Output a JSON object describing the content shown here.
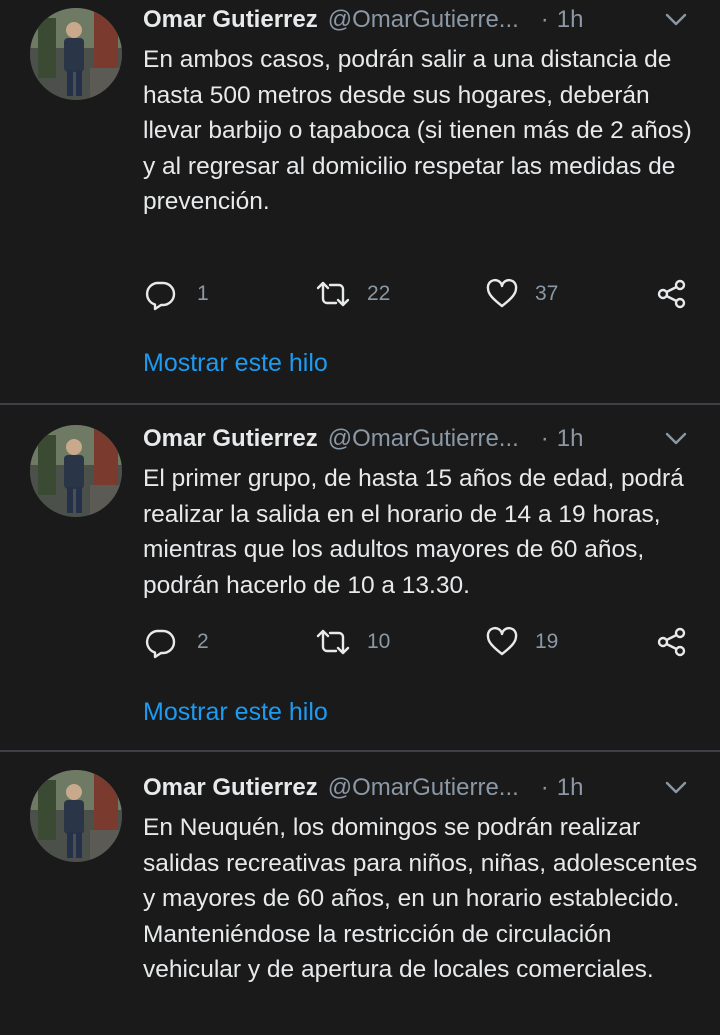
{
  "tweets": [
    {
      "author_name": "Omar Gutierrez",
      "handle": "@OmarGutierre...",
      "separator": "·",
      "time": "1h",
      "text": "En ambos casos, podrán salir a una distancia de hasta 500 metros desde sus hogares, deberán llevar barbijo o tapaboca (si tienen más de 2 años) y al regresar al domicilio respetar las medidas de prevención.",
      "replies": "1",
      "retweets": "22",
      "likes": "37",
      "thread_link": "Mostrar este hilo"
    },
    {
      "author_name": "Omar Gutierrez",
      "handle": "@OmarGutierre...",
      "separator": "·",
      "time": "1h",
      "text": "El primer grupo, de hasta 15 años de edad, podrá realizar la salida en el horario de 14 a 19 horas, mientras que los adultos mayores de 60 años, podrán hacerlo de 10 a 13.30.",
      "replies": "2",
      "retweets": "10",
      "likes": "19",
      "thread_link": "Mostrar este hilo"
    },
    {
      "author_name": "Omar Gutierrez",
      "handle": "@OmarGutierre...",
      "separator": "·",
      "time": "1h",
      "text": "En Neuquén, los domingos se podrán realizar salidas recreativas para niños, niñas, adolescentes y mayores de 60 años, en un horario establecido. Manteniéndose la restricción de circulación vehicular y de apertura de locales comerciales."
    }
  ],
  "icons": {
    "reply": "reply-icon",
    "retweet": "retweet-icon",
    "like": "heart-icon",
    "share": "share-icon",
    "more": "chevron-down-icon"
  },
  "colors": {
    "background": "#1a1a1b",
    "text": "#e7e9ea",
    "secondary": "#8b98a5",
    "link": "#1d9bf0",
    "divider": "#3d4145"
  }
}
